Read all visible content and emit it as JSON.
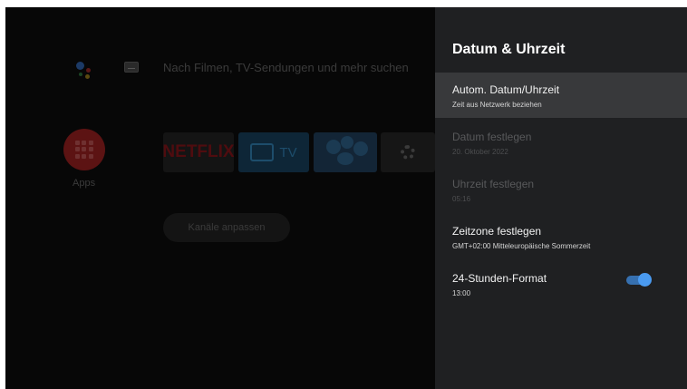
{
  "launcher": {
    "search_hint": "Nach Filmen, TV-Sendungen und mehr suchen",
    "apps_label": "Apps",
    "tiles": [
      "NETFLIX",
      "TV"
    ],
    "channels_button": "Kanäle anpassen"
  },
  "panel": {
    "title": "Datum & Uhrzeit",
    "options": [
      {
        "title": "Autom. Datum/Uhrzeit",
        "subtitle": "Zeit aus Netzwerk beziehen",
        "state": "focused"
      },
      {
        "title": "Datum festlegen",
        "subtitle": "20. Oktober 2022",
        "state": "disabled"
      },
      {
        "title": "Uhrzeit festlegen",
        "subtitle": "05:16",
        "state": "disabled"
      },
      {
        "title": "Zeitzone festlegen",
        "subtitle": "GMT+02:00 Mitteleuropäische Sommerzeit",
        "state": "enabled"
      },
      {
        "title": "24-Stunden-Format",
        "subtitle": "13:00",
        "state": "enabled",
        "toggle_on": true
      }
    ]
  },
  "colors": {
    "panel_bg": "#1f2022",
    "focused_row": "#38393b",
    "toggle_accent": "#4a9af0"
  },
  "icons": [
    "google-assistant-icon",
    "keyboard-icon",
    "apps-grid-icon",
    "tv-icon",
    "gear-icon"
  ]
}
